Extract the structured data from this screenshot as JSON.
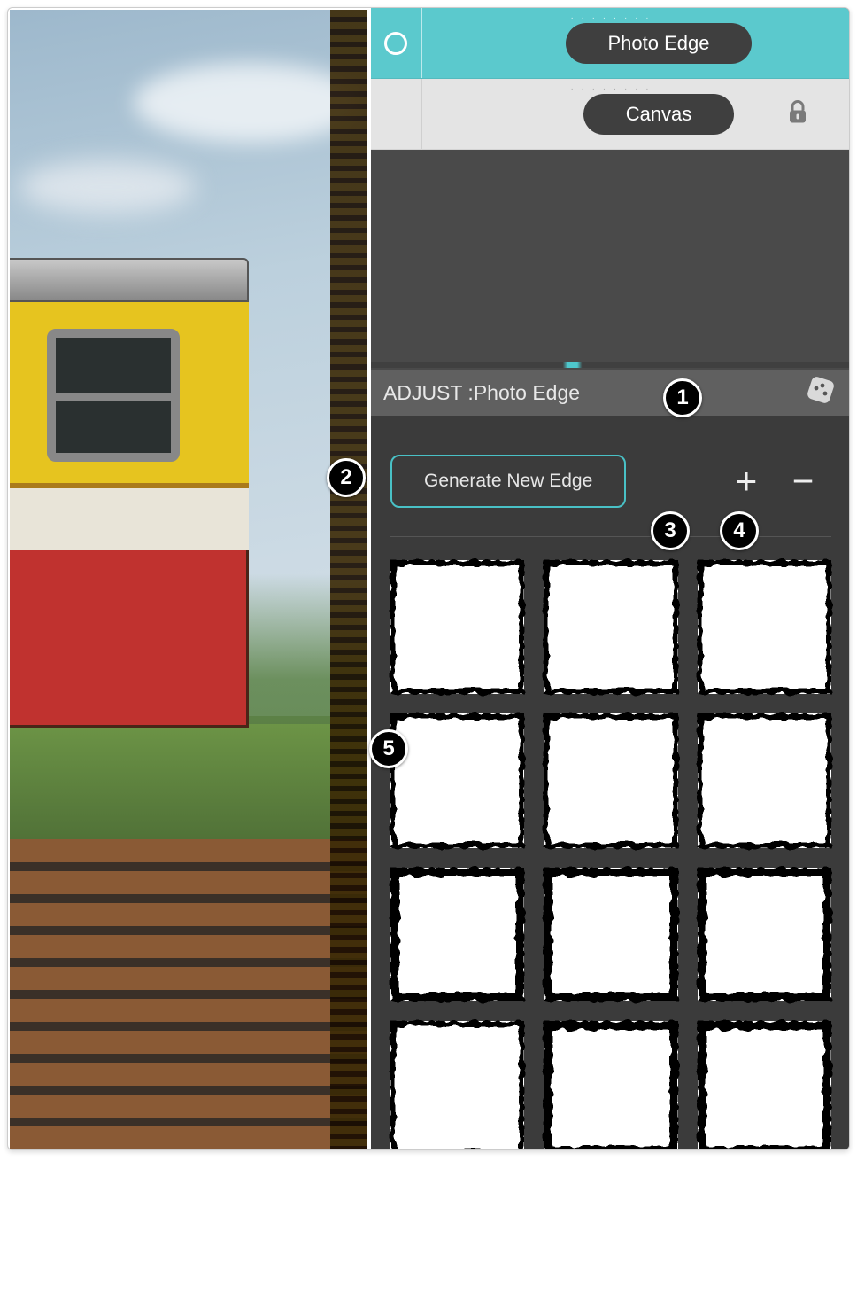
{
  "layers": {
    "grip_glyph": "· · · · · · · ·",
    "photo_edge_label": "Photo Edge",
    "canvas_label": "Canvas"
  },
  "adjust": {
    "header_prefix": "ADJUST : ",
    "header_name": "Photo Edge",
    "generate_label": "Generate New Edge",
    "plus_glyph": "+",
    "minus_glyph": "−"
  },
  "callouts": {
    "c1": "1",
    "c2": "2",
    "c3": "3",
    "c4": "4",
    "c5": "5"
  }
}
